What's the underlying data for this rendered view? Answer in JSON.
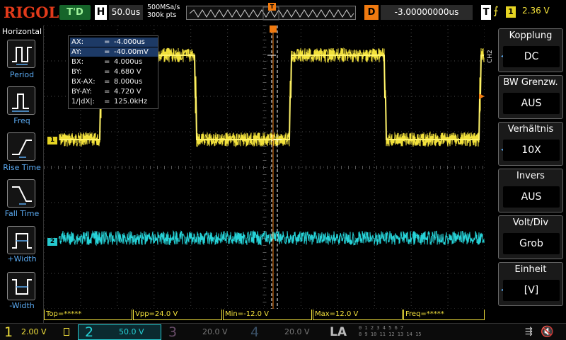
{
  "topbar": {
    "logo": "RIGOL",
    "run_status": "T'D",
    "horizontal_label": "H",
    "timebase": "50.0us",
    "sample_rate": "500MSa/s",
    "memory_depth": "300k pts",
    "trigger_marker": "T",
    "delay_label": "D",
    "delay_value": "-3.00000000us",
    "trigger_label": "T",
    "trigger_edge_icon": "rising-edge-icon",
    "trigger_source": "1",
    "trigger_level": "2.36 V"
  },
  "left_panel": {
    "title": "Horizontal",
    "items": [
      {
        "label": "Period",
        "icon": "period-icon"
      },
      {
        "label": "Freq",
        "icon": "frequency-icon"
      },
      {
        "label": "Rise Time",
        "icon": "rise-time-icon"
      },
      {
        "label": "Fall Time",
        "icon": "fall-time-icon"
      },
      {
        "label": "+Width",
        "icon": "positive-width-icon"
      },
      {
        "label": "-Width",
        "icon": "negative-width-icon"
      }
    ]
  },
  "cursor_readout": [
    {
      "key": "AX:",
      "eq": "=",
      "value": "-4.000us",
      "selected": true
    },
    {
      "key": "AY:",
      "eq": "=",
      "value": "-40.00mV",
      "selected": true
    },
    {
      "key": "BX:",
      "eq": "=",
      "value": "4.000us",
      "selected": false
    },
    {
      "key": "BY:",
      "eq": "=",
      "value": "4.680 V",
      "selected": false
    },
    {
      "key": "BX-AX:",
      "eq": "=",
      "value": "8.000us",
      "selected": false
    },
    {
      "key": "BY-AY:",
      "eq": "=",
      "value": "4.720 V",
      "selected": false
    },
    {
      "key": "1/|dX|:",
      "eq": "=",
      "value": "125.0kHz",
      "selected": false
    }
  ],
  "channel_markers": {
    "ch1": "1",
    "ch2": "2"
  },
  "measurements": [
    {
      "label": "Top=*****"
    },
    {
      "label": "Vpp=24.0 V"
    },
    {
      "label": "Min=-12.0 V"
    },
    {
      "label": "Max=12.0 V"
    },
    {
      "label": "Freq=*****"
    }
  ],
  "right_panel": {
    "channel_tag": "CH2",
    "items": [
      {
        "title": "Kopplung",
        "value": "DC"
      },
      {
        "title": "BW Grenzw.",
        "value": "AUS"
      },
      {
        "title": "Verhältnis",
        "value": "10X"
      },
      {
        "title": "Invers",
        "value": "AUS"
      },
      {
        "title": "Volt/Div",
        "value": "Grob"
      },
      {
        "title": "Einheit",
        "value": "[V]"
      }
    ]
  },
  "bottom_bar": {
    "ch1_num": "1",
    "ch1_scale": "2.00 V",
    "ch2_num": "2",
    "ch2_scale": "50.0 V",
    "ch3_num": "3",
    "ch3_scale": "20.0 V",
    "ch4_num": "4",
    "ch4_scale": "20.0 V",
    "la_label": "LA",
    "la_digits_row1": "0 1 2 3 4 5 6 7",
    "la_digits_row2": "8 9 10 11 12 13 14 15",
    "usb_icon": "usb-icon",
    "sound_icon": "speaker-muted-icon"
  },
  "colors": {
    "ch1": "#f2e13c",
    "ch2": "#26d3d8",
    "trigger": "#f07a10",
    "accent_blue": "#5aa9f0"
  }
}
